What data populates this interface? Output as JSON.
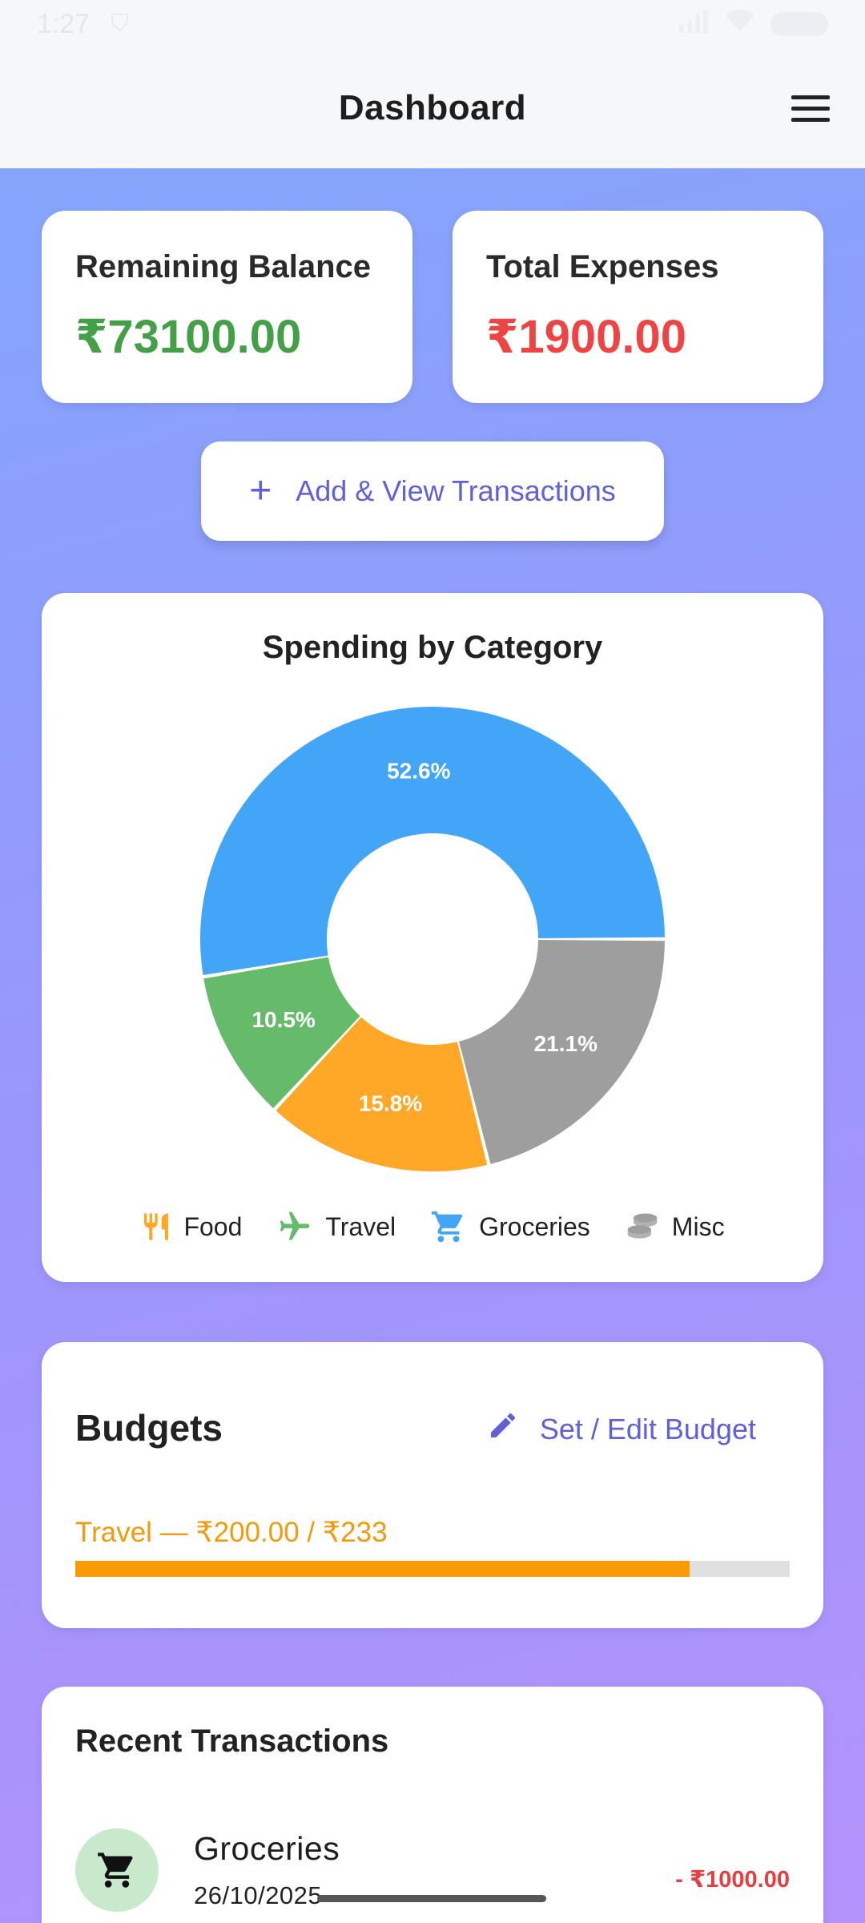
{
  "status_bar": {
    "time": "1:27"
  },
  "app_bar": {
    "title": "Dashboard"
  },
  "summary": {
    "balance_label": "Remaining Balance",
    "balance_value": "₹73100.00",
    "balance_color": "#43a047",
    "expenses_label": "Total Expenses",
    "expenses_value": "₹1900.00",
    "expenses_color": "#ef4444"
  },
  "add_button": {
    "label": "Add & View Transactions"
  },
  "chart_card": {
    "title": "Spending by Category"
  },
  "chart_data": {
    "type": "pie",
    "title": "Spending by Category",
    "donut": true,
    "slices": [
      {
        "label": "Misc",
        "percent": 21.1,
        "display": "21.1%",
        "color": "#9e9e9e"
      },
      {
        "label": "Food",
        "percent": 15.8,
        "display": "15.8%",
        "color": "#ffa726"
      },
      {
        "label": "Travel",
        "percent": 10.5,
        "display": "10.5%",
        "color": "#66bb6a"
      },
      {
        "label": "Groceries",
        "percent": 52.6,
        "display": "52.6%",
        "color": "#42a5f5"
      }
    ],
    "legend": [
      {
        "label": "Food",
        "icon": "fork-knife-icon",
        "color": "#ffa726"
      },
      {
        "label": "Travel",
        "icon": "airplane-icon",
        "color": "#66bb6a"
      },
      {
        "label": "Groceries",
        "icon": "cart-icon",
        "color": "#42a5f5"
      },
      {
        "label": "Misc",
        "icon": "coins-icon",
        "color": "#9e9e9e"
      }
    ],
    "legend_position": "bottom"
  },
  "budgets": {
    "title": "Budgets",
    "edit_label": "Set / Edit Budget",
    "items": [
      {
        "text": "Travel — ₹200.00 / ₹233",
        "spent": 200,
        "limit": 233,
        "fraction": 0.86
      }
    ]
  },
  "recent": {
    "title": "Recent Transactions",
    "items": [
      {
        "name": "Groceries",
        "date": "26/10/2025",
        "amount": "- ₹1000.00",
        "icon": "cart-icon"
      }
    ]
  }
}
